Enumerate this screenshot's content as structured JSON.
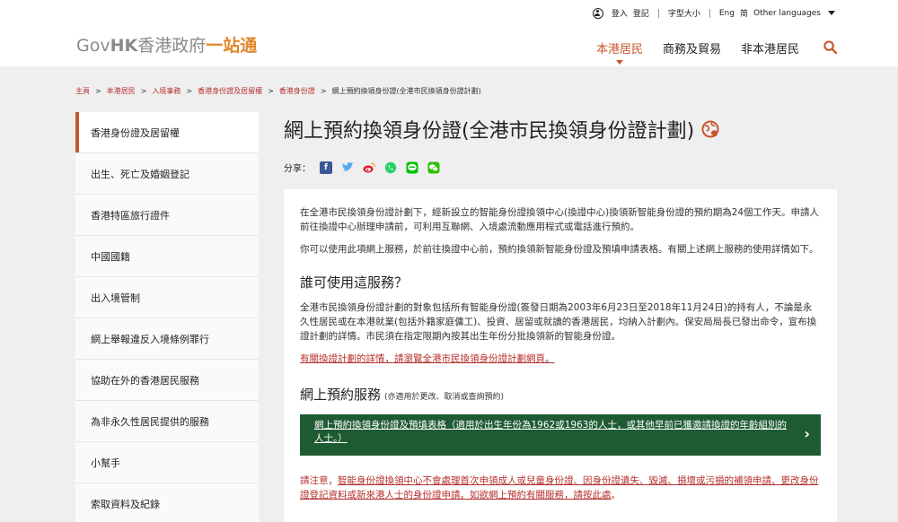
{
  "header": {
    "login": "登入",
    "register": "登記",
    "font_size": "字型大小",
    "lang_en": "Eng",
    "lang_sc": "简",
    "other_languages": "Other languages",
    "logo_gov": "Gov",
    "logo_hk": "HK",
    "logo_cn": "香港政府",
    "logo_orange": "一站通",
    "nav": [
      "本港居民",
      "商務及貿易",
      "非本港居民"
    ]
  },
  "breadcrumb": {
    "items": [
      "主頁",
      "本港居民",
      "入境事務",
      "香港身份證及居留權",
      "香港身份證"
    ],
    "current": "網上預約換領身份證(全港市民換領身份證計劃)"
  },
  "sidebar": {
    "items": [
      "香港身份證及居留權",
      "出生、死亡及婚姻登記",
      "香港特區旅行證件",
      "中國國籍",
      "出入境管制",
      "網上舉報違反入境條例罪行",
      "協助在外的香港居民服務",
      "為非永久性居民提供的服務",
      "小幫手",
      "索取資料及紀錄"
    ]
  },
  "content": {
    "title": "網上預約換領身份證(全港市民換領身份證計劃)",
    "share_label": "分享：",
    "para1": "在全港市民換領身份證計劃下，經新設立的智能身份證換領中心(換證中心)換領新智能身份證的預約期為24個工作天。申請人前往換證中心辦理申請前，可利用互聯網、入境處流動應用程式或電話進行預約。",
    "para2": "你可以使用此項網上服務，於前往換證中心前，預約換領新智能身份證及預填申請表格。有關上述網上服務的使用詳情如下。",
    "h_who": "誰可使用這服務？",
    "para3": "全港市民換領身份證計劃的對象包括所有智能身份證(簽發日期為2003年6月23日至2018年11月24日)的持有人，不論是永久性居民或在本港就業(包括外籍家庭傭工)、投資、居留或就讀的香港居民，均納入計劃內。保安局局長已發出命令，宣布換證計劃的詳情。市民須在指定限期內按其出生年份分批換領新的智能身份證。",
    "link_details": "有關換證計劃的詳情，請瀏覽全港市民換領身份證計劃網頁",
    "link_dot": "。",
    "h_online": "網上預約服務",
    "h_online_small": "(亦適用於更改、取消或查詢預約)",
    "green_button": "網上預約換領身份證及預填表格（適用於出生年份為1962或1963的人士，或其他早前已獲邀請換證的年齡組別的人士。）",
    "notice_text": "請注意，",
    "notice_link": "智能身份證換領中心不會處理首次申領成人或兒童身份證、因身份證遺失、毀滅、損壞或污損的補領申請、更改身份證登記資料或新來港人士的身份證申請。如欲網上預約有關服務，請按此處",
    "notice_end": "。"
  },
  "colors": {
    "accent": "#c7562d",
    "link": "#b5302d",
    "green": "#1e5b33"
  }
}
